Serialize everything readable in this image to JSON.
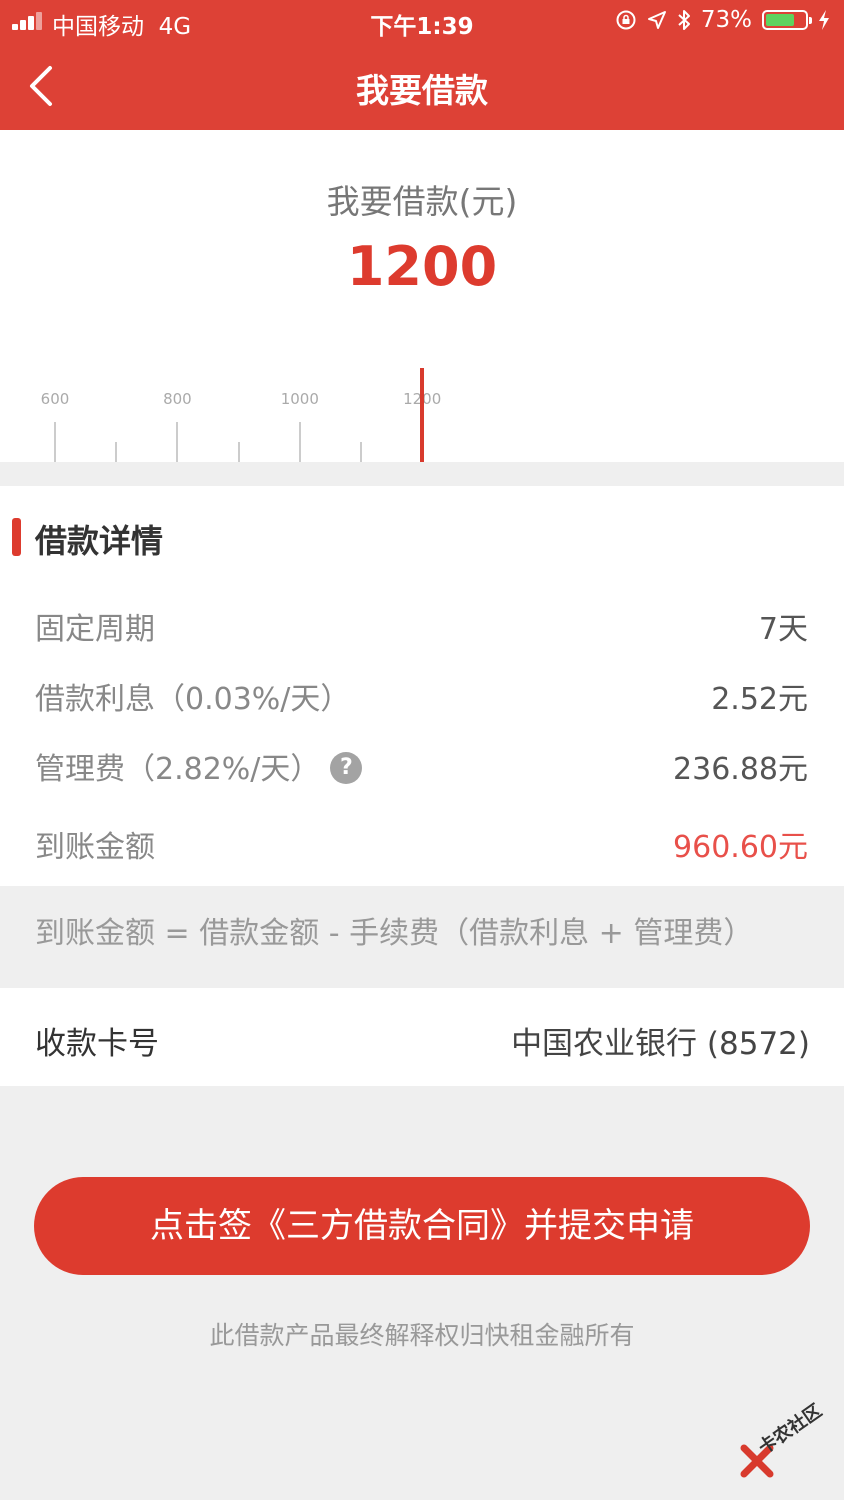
{
  "status_bar": {
    "carrier": "中国移动",
    "network": "4G",
    "time": "下午1:39",
    "battery_percent": "73%",
    "battery_level": 0.73,
    "icons": [
      "rotation-lock-icon",
      "location-arrow-icon",
      "bluetooth-icon",
      "battery-icon",
      "charging-bolt-icon"
    ]
  },
  "nav": {
    "title": "我要借款",
    "back_icon": "chevron-left-icon"
  },
  "amount": {
    "label": "我要借款(元)",
    "value": "1200"
  },
  "ruler": {
    "ticks": [
      600,
      700,
      800,
      900,
      1000,
      1100,
      1200
    ],
    "labels": [
      "600",
      "800",
      "1000",
      "1200"
    ],
    "selected": 1200
  },
  "details": {
    "title": "借款详情",
    "period_label": "固定周期",
    "period_value": "7天",
    "interest_label": "借款利息（0.03%/天）",
    "interest_value": "2.52元",
    "fee_label": "管理费（2.82%/天）",
    "fee_help_icon": "question-circle-icon",
    "fee_help_glyph": "?",
    "fee_value": "236.88元",
    "received_label": "到账金额",
    "received_value": "960.60元"
  },
  "formula": "到账金额 = 借款金额 - 手续费（借款利息 + 管理费）",
  "card": {
    "label": "收款卡号",
    "value": "中国农业银行 (8572)"
  },
  "submit_label": "点击签《三方借款合同》并提交申请",
  "footnote": "此借款产品最终解释权归快租金融所有",
  "watermark_text": "卡农社区",
  "colors": {
    "brand_red": "#dd4136",
    "amount_red": "#dd3b2e",
    "received_red": "#e8504a",
    "battery_green": "#5fd35f"
  }
}
